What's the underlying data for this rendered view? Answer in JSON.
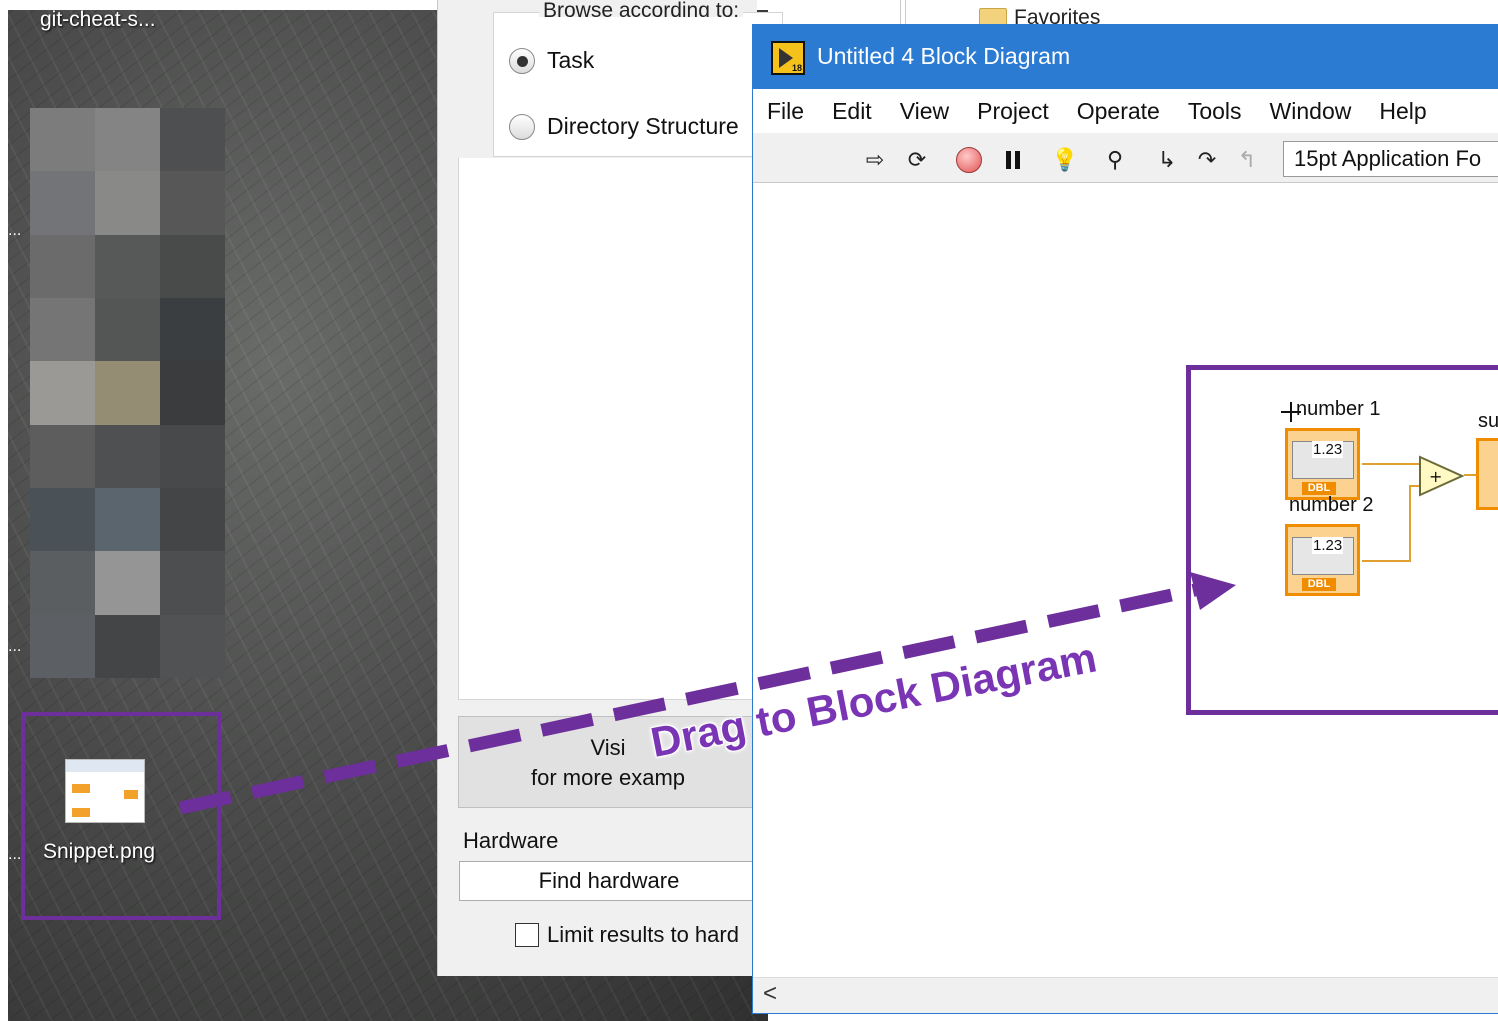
{
  "desktop": {
    "top_label": "git-cheat-s...",
    "file_label": "Snippet.png",
    "ellipsis_1": "...",
    "ellipsis_2": "...",
    "ellipsis_3": "..."
  },
  "dialog": {
    "browse_legend": "Browse according to:",
    "radio_task": "Task",
    "radio_directory": "Directory Structure",
    "visit_line1": "Visi",
    "visit_line2": "for more examp",
    "hardware_label": "Hardware",
    "find_hardware_button": "Find hardware",
    "limit_results_label": "Limit results to hard"
  },
  "explorer": {
    "favorites_label": "Favorites"
  },
  "block_diagram": {
    "window_title": "Untitled 4 Block Diagram",
    "app_icon_version": "18",
    "menu": [
      "File",
      "Edit",
      "View",
      "Project",
      "Operate",
      "Tools",
      "Window",
      "Help"
    ],
    "font_select": "15pt Application Fo",
    "toolbar_icons": [
      "run-arrow-icon",
      "run-continuously-icon",
      "abort-icon",
      "pause-icon",
      "highlight-execution-icon",
      "retain-wire-values-icon",
      "step-into-icon",
      "step-over-icon",
      "step-out-icon"
    ],
    "control_1_label": "number 1",
    "control_2_label": "number 2",
    "control_value": "1.23",
    "control_type": "DBL",
    "indicator_label": "su",
    "add_symbol": "+",
    "scroll_left": "<"
  },
  "annotation": {
    "caption": "Drag to Block Diagram",
    "color": "#6d2f9b"
  },
  "colors": {
    "title_bar": "#2b7bd3",
    "wire": "#e0a030",
    "control_border": "#f08c00"
  }
}
